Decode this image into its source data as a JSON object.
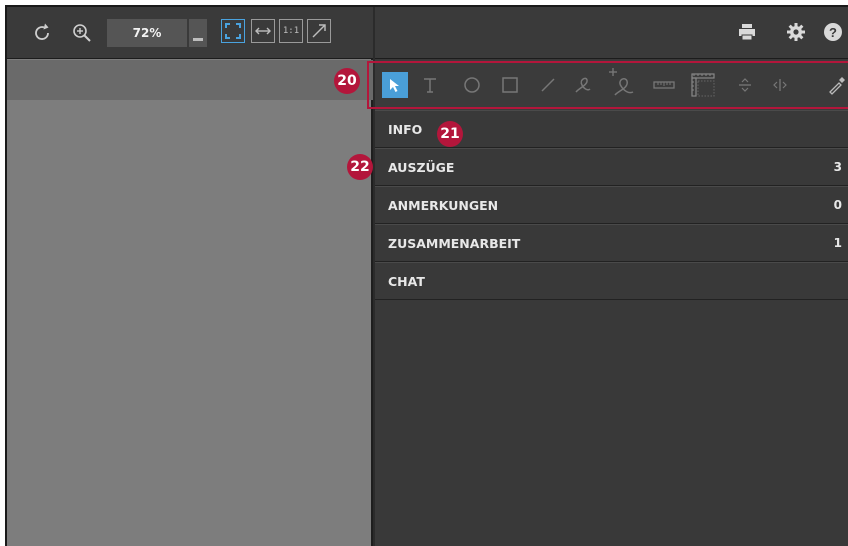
{
  "viewer": {
    "zoom_value": "72%",
    "fit_labels": {
      "actual_size": "1:1"
    }
  },
  "callouts": {
    "tools": "20",
    "info": "21",
    "panels": "22"
  },
  "panels": [
    {
      "label": "INFO",
      "count": ""
    },
    {
      "label": "AUSZÜGE",
      "count": "3"
    },
    {
      "label": "ANMERKUNGEN",
      "count": "0"
    },
    {
      "label": "ZUSAMMENARBEIT",
      "count": "1"
    },
    {
      "label": "CHAT",
      "count": ""
    }
  ],
  "colors": {
    "accent": "#4a9fd8",
    "callout": "#b3163b",
    "panel_bg": "#393939",
    "canvas_bg": "#7d7d7d"
  },
  "tools": [
    "select-tool",
    "text-tool",
    "circle-tool",
    "rectangle-tool",
    "line-tool",
    "freehand-tool",
    "add-freehand-tool",
    "ruler-tool",
    "area-measure-tool",
    "vertical-split-tool",
    "horizontal-split-tool",
    "eyedropper-tool"
  ]
}
